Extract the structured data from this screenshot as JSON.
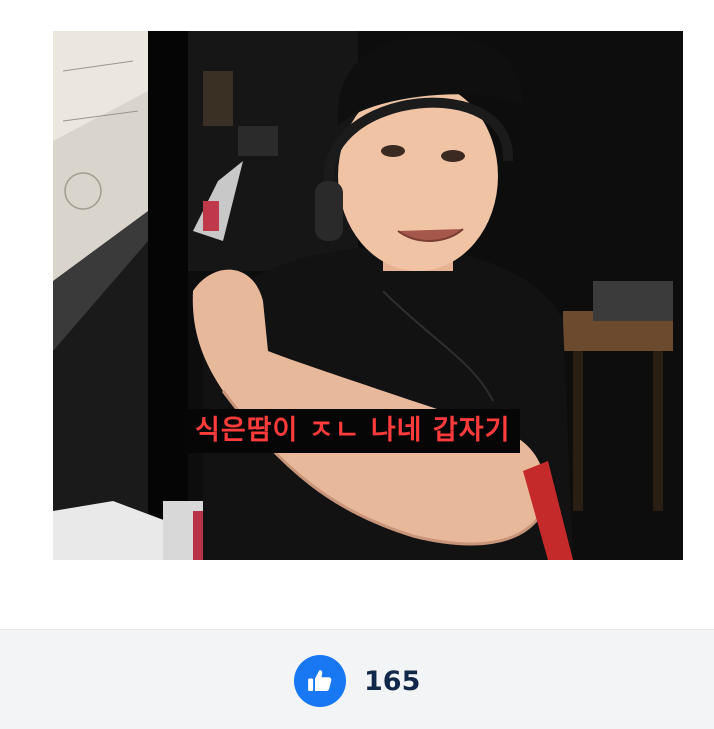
{
  "media": {
    "caption": "식은땀이 ㅈㄴ 나네 갑자기",
    "caption_color": "#ff3b3b"
  },
  "reactions": {
    "like_icon": "thumbs-up-icon",
    "like_count": "165",
    "accent_color": "#1877f2"
  }
}
